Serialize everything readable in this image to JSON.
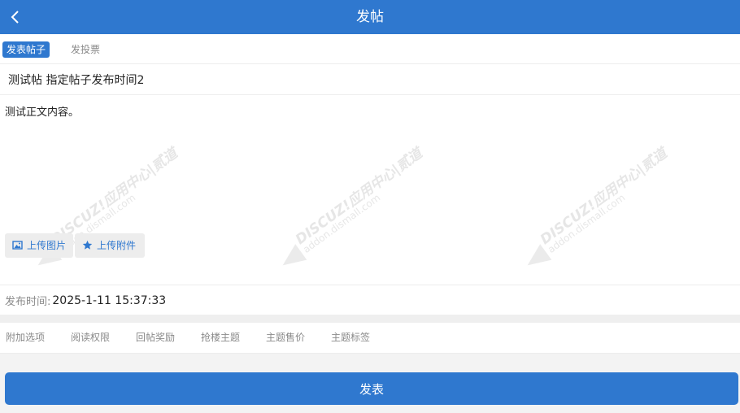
{
  "header": {
    "title": "发帖",
    "back_icon": "chevron-left-icon"
  },
  "tabs": [
    {
      "label": "发表帖子",
      "active": true
    },
    {
      "label": "发投票",
      "active": false
    }
  ],
  "subject": {
    "value": "测试帖 指定帖子发布时间2"
  },
  "content": {
    "value": "测试正文内容。"
  },
  "uploads": [
    {
      "label": "上传图片",
      "icon": "image-icon"
    },
    {
      "label": "上传附件",
      "icon": "star-icon"
    }
  ],
  "publish_time": {
    "label": "发布时间:",
    "value": "2025-1-11 15:37:33"
  },
  "options": [
    "附加选项",
    "阅读权限",
    "回帖奖励",
    "抢楼主题",
    "主题售价",
    "主题标签"
  ],
  "submit": {
    "label": "发表"
  },
  "watermark": {
    "line1": "DISCUZ!应用中心|贰道",
    "line2": "addon.dismall.com"
  },
  "colors": {
    "accent": "#2f78cf",
    "divider": "#ededed",
    "muted": "#8a8a8a"
  }
}
